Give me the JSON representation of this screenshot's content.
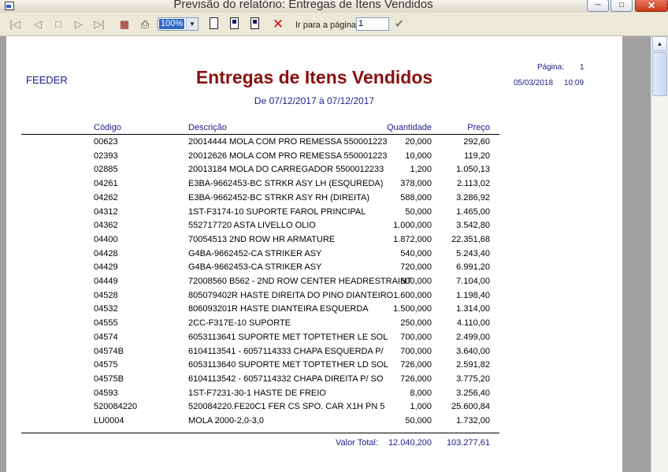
{
  "window": {
    "title": "Previsão do relatório: Entregas de Itens Vendidos"
  },
  "toolbar": {
    "zoom": "100%",
    "goto_label": "Ir para a página",
    "goto_value": "1"
  },
  "report": {
    "company": "FEEDER",
    "title": "Entregas de Itens Vendidos",
    "period": "De 07/12/2017 à 07/12/2017",
    "page_label": "Página:",
    "page_number": "1",
    "date": "05/03/2018",
    "time": "10:09",
    "columns": {
      "code": "Código",
      "description": "Descrição",
      "quantity": "Quantidade",
      "price": "Preço"
    },
    "rows": [
      {
        "code": "00623",
        "description": "20014444 MOLA COM PRO REMESSA 550001223",
        "quantity": "20,000",
        "price": "292,60"
      },
      {
        "code": "02393",
        "description": "20012626 MOLA COM PRO REMESSA 550001223",
        "quantity": "10,000",
        "price": "119,20"
      },
      {
        "code": "02885",
        "description": "20013184 MOLA DO CARREGADOR 5500012233",
        "quantity": "1,200",
        "price": "1.050,13"
      },
      {
        "code": "04261",
        "description": "E3BA-9662453-BC STRKR ASY LH (ESQUREDA)",
        "quantity": "378,000",
        "price": "2.113,02"
      },
      {
        "code": "04262",
        "description": "E3BA-9662452-BC STRKR ASY RH (DIREITA)",
        "quantity": "588,000",
        "price": "3.286,92"
      },
      {
        "code": "04312",
        "description": "1ST-F3174-10 SUPORTE FAROL PRINCIPAL",
        "quantity": "50,000",
        "price": "1.465,00"
      },
      {
        "code": "04362",
        "description": "552717720 ASTA LIVELLO OLIO",
        "quantity": "1.000,000",
        "price": "3.542,80"
      },
      {
        "code": "04400",
        "description": "70054513 2ND ROW HR ARMATURE",
        "quantity": "1.872,000",
        "price": "22.351,68"
      },
      {
        "code": "04428",
        "description": "G4BA-9662452-CA STRIKER ASY",
        "quantity": "540,000",
        "price": "5.243,40"
      },
      {
        "code": "04429",
        "description": "G4BA-9662453-CA STRIKER ASY",
        "quantity": "720,000",
        "price": "6.991,20"
      },
      {
        "code": "04449",
        "description": "72008560 B562 - 2ND ROW CENTER HEADRESTRAINT",
        "quantity": "600,000",
        "price": "7.104,00"
      },
      {
        "code": "04528",
        "description": "805079402R HASTE DIREITA DO PINO DIANTEIRO",
        "quantity": "1.600,000",
        "price": "1.198,40"
      },
      {
        "code": "04532",
        "description": "806093201R HASTE DIANTEIRA ESQUERDA",
        "quantity": "1.500,000",
        "price": "1.314,00"
      },
      {
        "code": "04555",
        "description": "2CC-F317E-10 SUPORTE",
        "quantity": "250,000",
        "price": "4.110,00"
      },
      {
        "code": "04574",
        "description": "6053113641 SUPORTE MET TOPTETHER LE SOL",
        "quantity": "700,000",
        "price": "2.499,00"
      },
      {
        "code": "04574B",
        "description": "6104113541 - 6057114333 CHAPA ESQUERDA P/",
        "quantity": "700,000",
        "price": "3.640,00"
      },
      {
        "code": "04575",
        "description": "6053113640 SUPORTE MET TOPTETHER LD SOL",
        "quantity": "726,000",
        "price": "2.591,82"
      },
      {
        "code": "04575B",
        "description": "6104113542 - 6057114332 CHAPA DIREITA P/ SO",
        "quantity": "726,000",
        "price": "3.775,20"
      },
      {
        "code": "04593",
        "description": "1ST-F7231-30-1 HASTE DE FREIO",
        "quantity": "8,000",
        "price": "3.256,40"
      },
      {
        "code": "520084220",
        "description": "520084220.FE20C1 FER CS SPO. CAR X1H PN 5",
        "quantity": "1,000",
        "price": "25.600,84"
      },
      {
        "code": "LU0004",
        "description": "MOLA 2000-2,0-3,0",
        "quantity": "50,000",
        "price": "1.732,00"
      }
    ],
    "total_label": "Valor Total:",
    "total_quantity": "12.040,200",
    "total_price": "103.277,61"
  },
  "icons": [
    "first-page-icon",
    "prev-page-icon",
    "stop-icon",
    "next-page-icon",
    "last-page-icon",
    "print-setup-icon",
    "print-icon",
    "single-page-icon",
    "two-pages-icon",
    "multi-page-icon",
    "close-report-icon",
    "go-check-icon"
  ],
  "colors": {
    "title": "#8a1010",
    "labels": "#1c1c8a",
    "selection": "#316ac5"
  }
}
